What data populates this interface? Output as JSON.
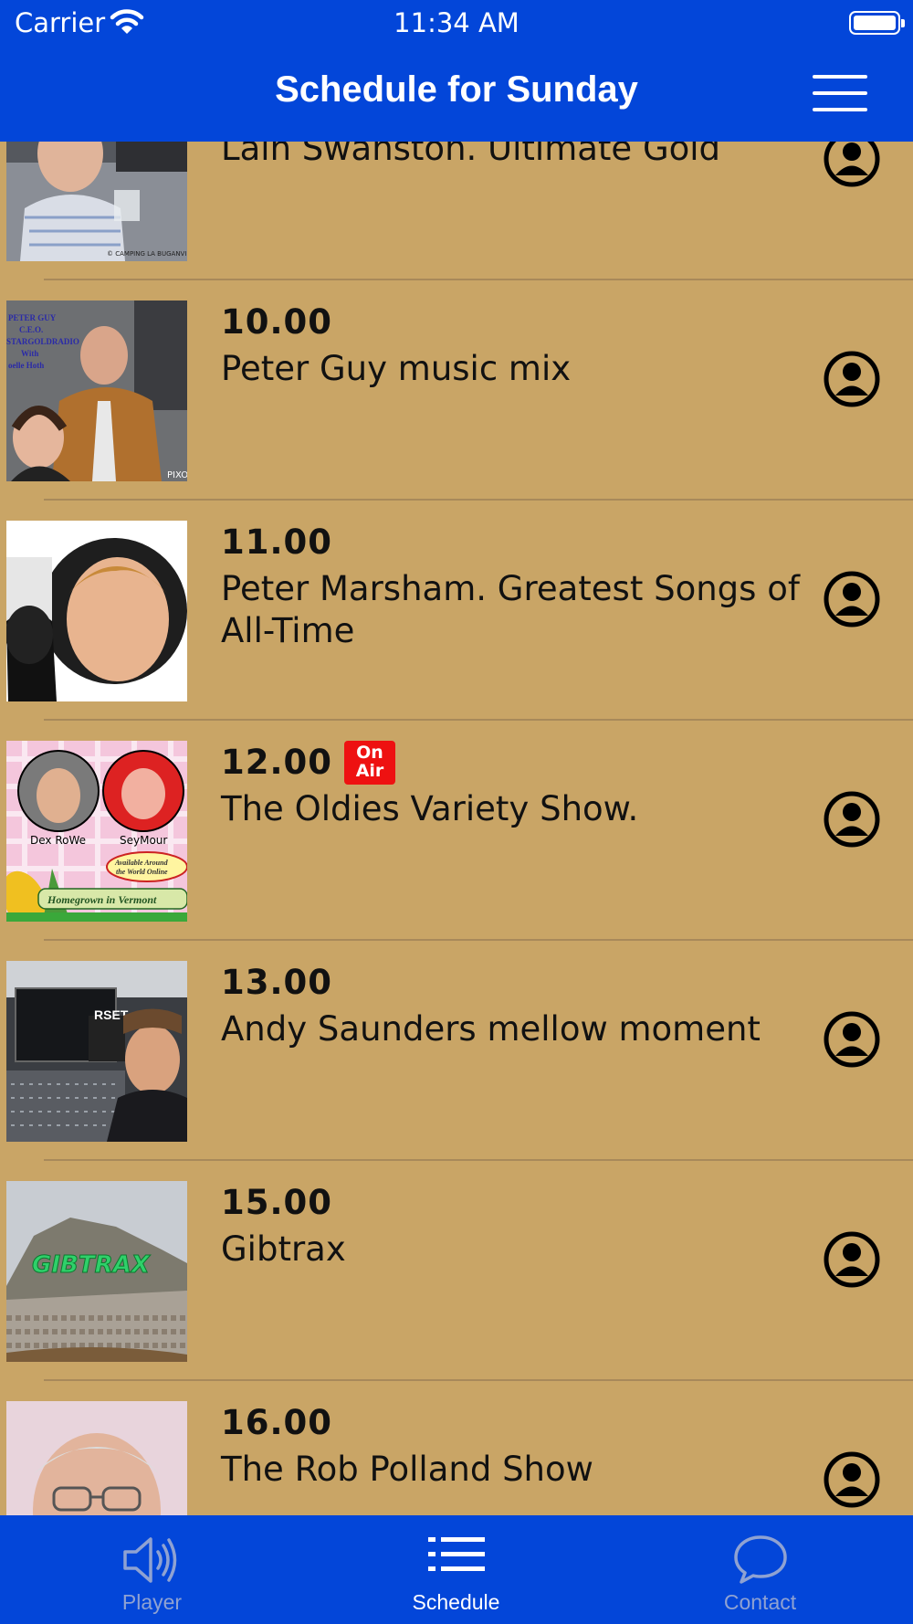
{
  "status_bar": {
    "carrier": "Carrier",
    "time": "11:34 AM"
  },
  "nav": {
    "title": "Schedule for Sunday"
  },
  "schedule": [
    {
      "time": "",
      "title": "Lain Swanston. Ultimate Gold",
      "on_air": false
    },
    {
      "time": "10.00",
      "title": "Peter Guy music mix",
      "on_air": false
    },
    {
      "time": "11.00",
      "title": "Peter Marsham. Greatest Songs of All-Time",
      "on_air": false
    },
    {
      "time": "12.00",
      "title": "The Oldies Variety Show.",
      "on_air": true
    },
    {
      "time": "13.00",
      "title": "Andy Saunders mellow moment",
      "on_air": false
    },
    {
      "time": "15.00",
      "title": "Gibtrax",
      "on_air": false
    },
    {
      "time": "16.00",
      "title": "The Rob Polland Show",
      "on_air": false
    }
  ],
  "on_air_badge": {
    "line1": "On",
    "line2": "Air"
  },
  "thumb_text": {
    "camping": "© CAMPING LA BUGANVILLA",
    "peter_guy_lines": [
      "PETER GUY",
      "C.E.O.",
      "STARGOLDRADIO",
      "With",
      "oelle Hoth"
    ],
    "pixo": "PIXO",
    "dex": "Dex RoWe",
    "seymour": "SeyMour",
    "available": "Available Around",
    "world": "the World Online",
    "homegrown": "Homegrown in Vermont",
    "rset": "RSET",
    "gibtrax": "GIBTRAX"
  },
  "tabs": [
    {
      "label": "Player",
      "icon": "speaker-icon",
      "active": false
    },
    {
      "label": "Schedule",
      "icon": "list-icon",
      "active": true
    },
    {
      "label": "Contact",
      "icon": "chat-bubble-icon",
      "active": false
    }
  ],
  "colors": {
    "nav_blue": "#0346d9",
    "list_background": "#c9a566",
    "separator": "#a8895a",
    "on_air_red": "#e11111",
    "inactive_tab": "#8fa2d2"
  }
}
